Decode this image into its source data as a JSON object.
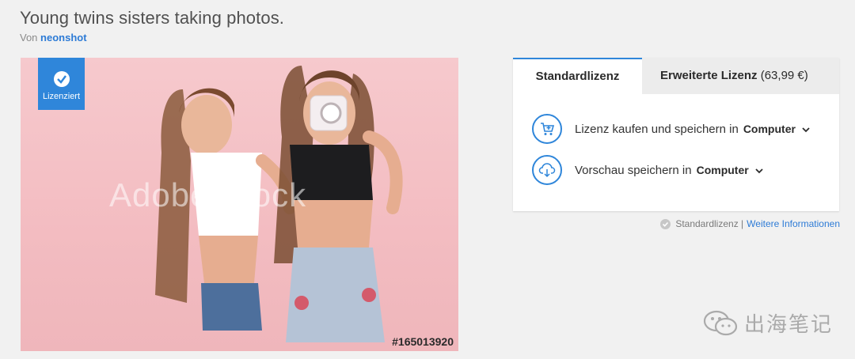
{
  "page": {
    "title": "Young twins sisters taking photos.",
    "byline_prefix": "Von",
    "author": "neonshot"
  },
  "image": {
    "badge_label": "Lizenziert",
    "watermark": "Adobe Stock",
    "asset_id": "#165013920"
  },
  "license_panel": {
    "tabs": [
      {
        "label": "Standardlizenz",
        "active": true
      },
      {
        "label": "Erweiterte Lizenz",
        "price": "(63,99 €)",
        "active": false
      }
    ],
    "actions": [
      {
        "text": "Lizenz kaufen und speichern in",
        "destination": "Computer",
        "icon": "cart-icon"
      },
      {
        "text": "Vorschau speichern in",
        "destination": "Computer",
        "icon": "cloud-download-icon"
      }
    ]
  },
  "footnote": {
    "license_type": "Standardlizenz |",
    "link": "Weitere Informationen"
  },
  "overlay": {
    "wechat_label": "出海笔记"
  },
  "colors": {
    "accent": "#2f86da",
    "background": "#f1f1f1",
    "photo_pink": "#f4c1c6"
  }
}
